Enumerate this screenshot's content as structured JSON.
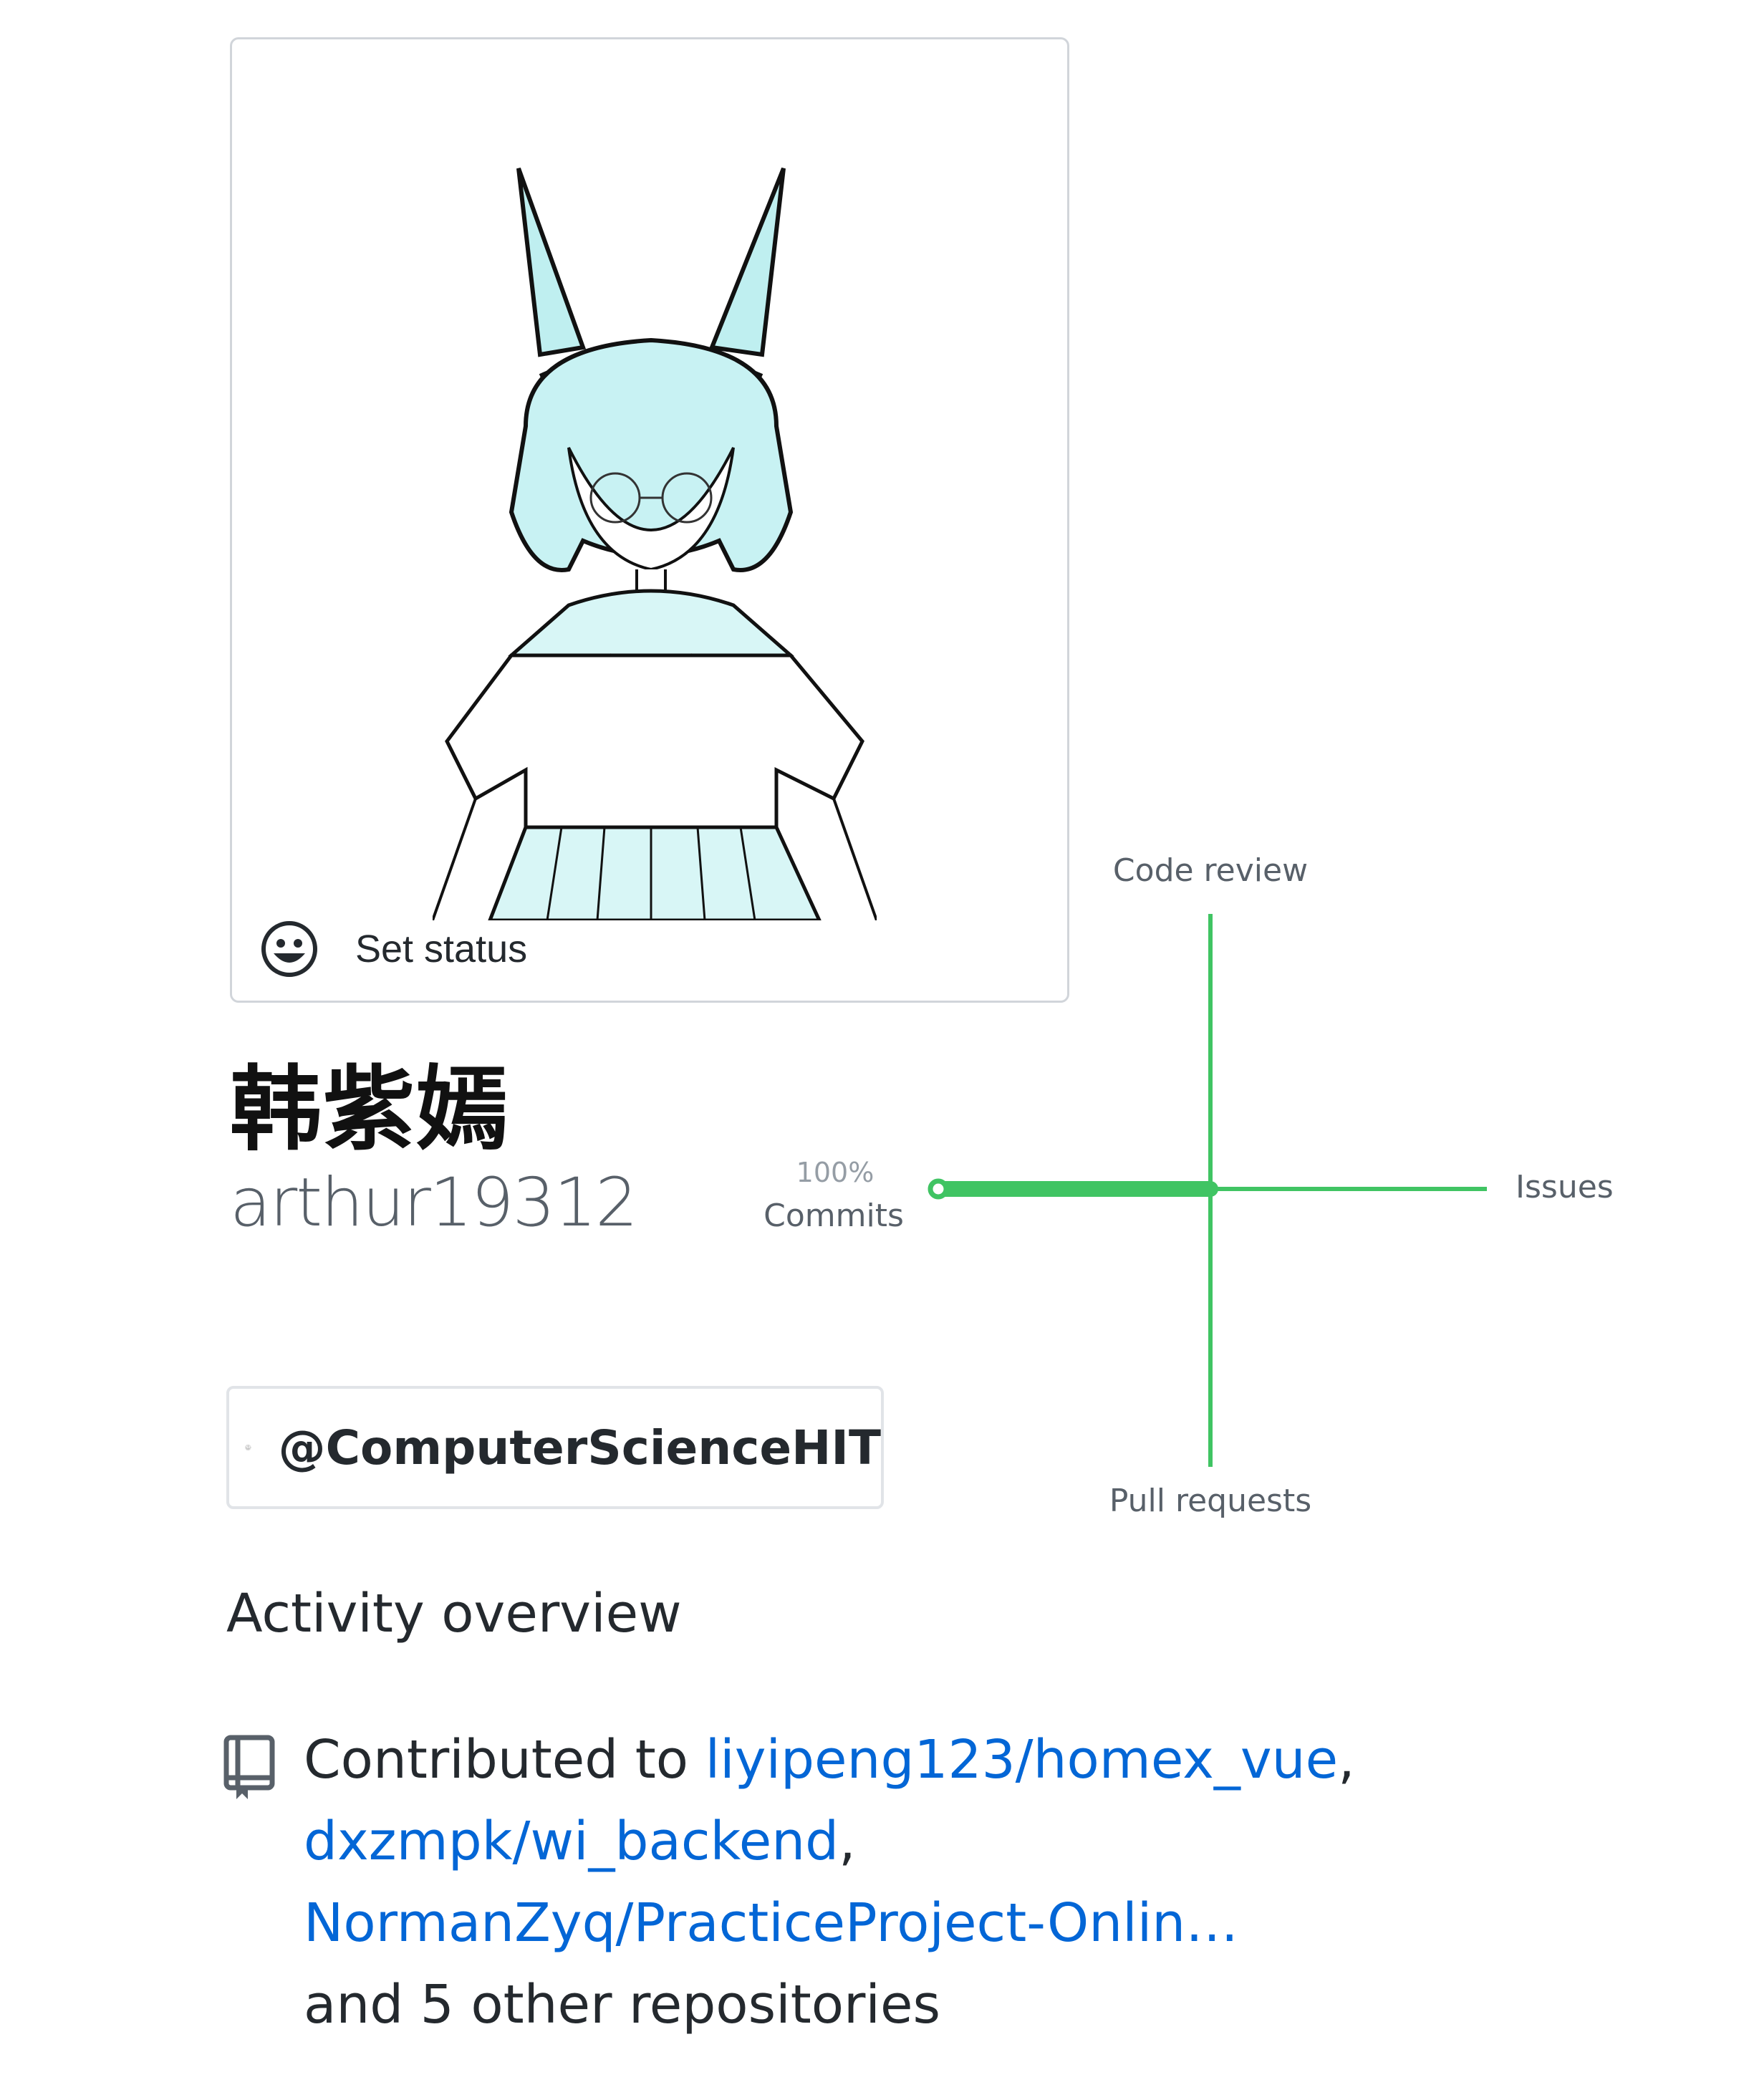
{
  "profile": {
    "status_label": "Set status",
    "status_icon": "smiley-icon",
    "name": "韩紫嫣",
    "login": "arthur19312"
  },
  "organization": {
    "handle": "@ComputerScienceHIT",
    "logo": "university-seal-icon"
  },
  "activity": {
    "title": "Activity overview",
    "icon": "repo-icon",
    "contributed_prefix": "Contributed to ",
    "repos": [
      "liyipeng123/homex_vue",
      "dxzmpk/wi_backend",
      "NormanZyq/PracticeProject-Onlin…"
    ],
    "separator": ",",
    "others": "and 5 other repositories"
  },
  "contribution_graph": {
    "axes": {
      "top": "Code review",
      "right": "Issues",
      "bottom": "Pull requests",
      "left": "Commits"
    },
    "left_percent": "100%",
    "values": {
      "commits": 100,
      "issues": 0,
      "pull_requests": 0,
      "code_review": 0
    },
    "color": "#40c463"
  }
}
